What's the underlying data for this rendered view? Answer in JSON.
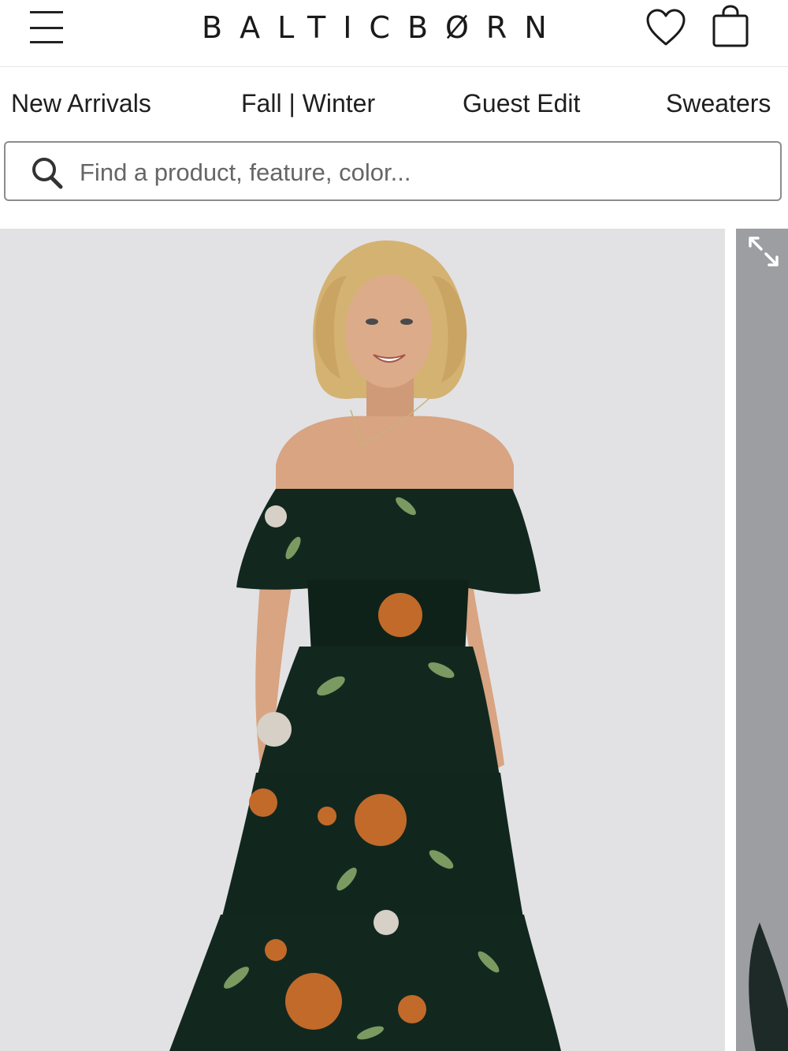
{
  "header": {
    "brand": "BALTICBØRN",
    "menu_icon": "hamburger-menu-icon",
    "wishlist_icon": "heart-icon",
    "bag_icon": "shopping-bag-icon"
  },
  "nav": {
    "items": [
      {
        "label": "New Arrivals"
      },
      {
        "label": "Fall | Winter"
      },
      {
        "label": "Guest Edit"
      },
      {
        "label": "Sweaters"
      }
    ]
  },
  "search": {
    "placeholder": "Find a product, feature, color...",
    "value": "",
    "icon": "search-icon"
  },
  "gallery": {
    "expand_icon": "expand-icon",
    "colors": {
      "background": "#e2e2e4",
      "dress": "#12281f",
      "flower_orange": "#c26a2a",
      "leaf_green": "#7a9a62",
      "skin": "#d8a482",
      "hair": "#d4b272"
    }
  },
  "colors": {
    "text": "#1a1a1a",
    "border": "#8c8c8c",
    "divider": "#e6e6e6"
  }
}
